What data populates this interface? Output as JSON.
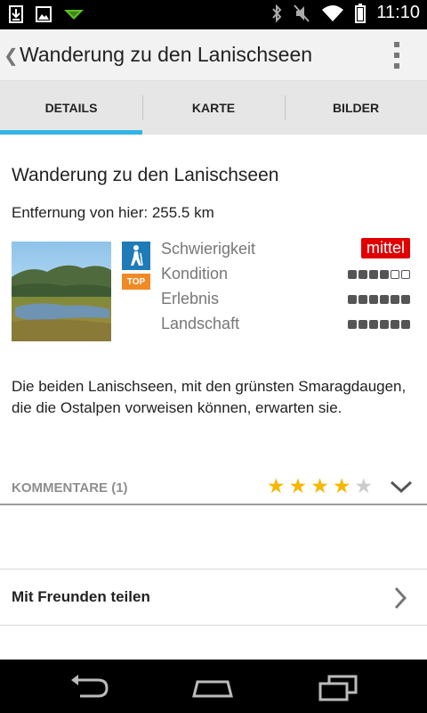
{
  "status_bar": {
    "time": "11:10",
    "left_icons": [
      "download-icon",
      "image-icon",
      "app-notification-icon"
    ],
    "right_icons": [
      "bluetooth-icon",
      "mute-icon",
      "wifi-icon",
      "battery-icon"
    ]
  },
  "action_bar": {
    "title": "Wanderung zu den Lanischseen",
    "back_icon": "chevron-left-icon",
    "overflow_icon": "overflow-menu-icon"
  },
  "tabs": [
    {
      "label": "DETAILS",
      "selected": true
    },
    {
      "label": "KARTE",
      "selected": false
    },
    {
      "label": "BILDER",
      "selected": false
    }
  ],
  "colors": {
    "accent": "#33b5e5",
    "difficulty_badge": "#e00000",
    "star": "#f5b800",
    "hike_badge": "#1f7ab8",
    "top_badge": "#f08a24"
  },
  "details": {
    "heading": "Wanderung zu den Lanischseen",
    "distance": "Entfernung von hier: 255.5 km",
    "top_badge": "TOP",
    "attributes": [
      {
        "label": "Schwierigkeit",
        "value": "mittel"
      },
      {
        "label": "Kondition",
        "rating": 4,
        "max": 6
      },
      {
        "label": "Erlebnis",
        "rating": 6,
        "max": 6
      },
      {
        "label": "Landschaft",
        "rating": 6,
        "max": 6
      }
    ],
    "description": "Die beiden Lanischseen, mit den grünsten Smaragdaugen, die die Ostalpen vorweisen können, erwarten sie."
  },
  "comments": {
    "label": "KOMMENTARE (1)",
    "stars": 4,
    "max_stars": 5
  },
  "share": {
    "label": "Mit Freunden teilen"
  },
  "nav_bar": {
    "buttons": [
      "back-nav-icon",
      "home-nav-icon",
      "recent-apps-icon"
    ]
  }
}
